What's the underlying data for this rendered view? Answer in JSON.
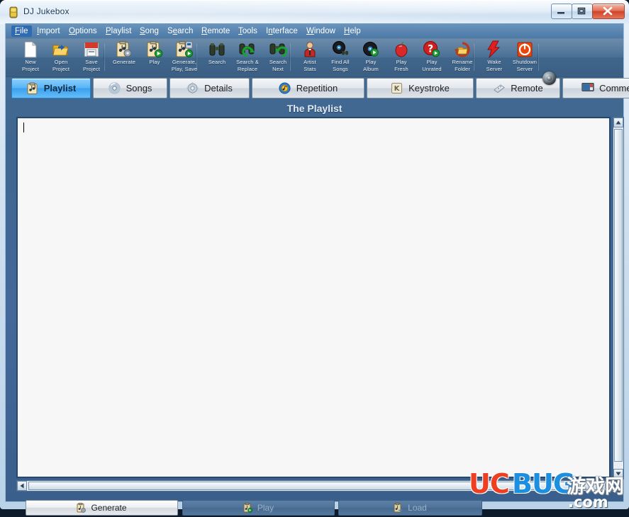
{
  "window": {
    "title": "DJ Jukebox",
    "app_icon": "jukebox-icon",
    "minimize_label": "Minimize",
    "maximize_label": "Maximize",
    "close_label": "Close"
  },
  "menubar": {
    "items": [
      {
        "label": "File",
        "mnemonic": "F",
        "active": true
      },
      {
        "label": "Import",
        "mnemonic": "I",
        "active": false
      },
      {
        "label": "Options",
        "mnemonic": "O",
        "active": false
      },
      {
        "label": "Playlist",
        "mnemonic": "P",
        "active": false
      },
      {
        "label": "Song",
        "mnemonic": "S",
        "active": false
      },
      {
        "label": "Search",
        "mnemonic": "e",
        "active": false
      },
      {
        "label": "Remote",
        "mnemonic": "R",
        "active": false
      },
      {
        "label": "Tools",
        "mnemonic": "T",
        "active": false
      },
      {
        "label": "Interface",
        "mnemonic": "n",
        "active": false
      },
      {
        "label": "Window",
        "mnemonic": "W",
        "active": false
      },
      {
        "label": "Help",
        "mnemonic": "H",
        "active": false
      }
    ]
  },
  "toolbar": {
    "buttons": [
      {
        "line1": "New",
        "line2": "Project",
        "icon": "new-document-icon"
      },
      {
        "line1": "Open",
        "line2": "Project",
        "icon": "open-folder-icon"
      },
      {
        "line1": "Save",
        "line2": "Project",
        "icon": "save-disk-icon"
      },
      {
        "line1": "Generate",
        "line2": "",
        "icon": "clipboard-gear-icon"
      },
      {
        "line1": "Play",
        "line2": "",
        "icon": "clipboard-play-icon"
      },
      {
        "line1": "Generate,",
        "line2": "Play, Save",
        "icon": "clipboard-generate-play-save-icon"
      },
      {
        "line1": "Search",
        "line2": "",
        "icon": "binoculars-icon"
      },
      {
        "line1": "Search &",
        "line2": "Replace",
        "icon": "binoculars-replace-icon"
      },
      {
        "line1": "Search",
        "line2": "Next",
        "icon": "binoculars-next-icon"
      },
      {
        "line1": "Artist",
        "line2": "Stats",
        "icon": "artist-person-icon"
      },
      {
        "line1": "Find All",
        "line2": "Songs",
        "icon": "find-all-songs-icon"
      },
      {
        "line1": "Play",
        "line2": "Album",
        "icon": "play-album-icon"
      },
      {
        "line1": "Play",
        "line2": "Fresh",
        "icon": "apple-icon"
      },
      {
        "line1": "Play",
        "line2": "Unrated",
        "icon": "question-play-icon"
      },
      {
        "line1": "Rename",
        "line2": "Folder",
        "icon": "rename-folder-icon"
      },
      {
        "line1": "Wake",
        "line2": "Server",
        "icon": "wake-server-icon"
      },
      {
        "line1": "Shutdown",
        "line2": "Server",
        "icon": "shutdown-server-icon"
      }
    ],
    "volume_label": "Volume"
  },
  "tabs": [
    {
      "label": "Playlist",
      "icon": "playlist-clipboard-icon",
      "selected": true
    },
    {
      "label": "Songs",
      "icon": "cd-disc-icon",
      "selected": false
    },
    {
      "label": "Details",
      "icon": "gear-icon",
      "selected": false
    },
    {
      "label": "Repetition",
      "icon": "repeat-circle-icon",
      "selected": false
    },
    {
      "label": "Keystroke",
      "icon": "key-k-icon",
      "selected": false
    },
    {
      "label": "Remote",
      "icon": "remote-control-icon",
      "selected": false
    },
    {
      "label": "Commercials",
      "icon": "tv-screen-icon",
      "selected": false
    }
  ],
  "page": {
    "header": "The Playlist"
  },
  "editor": {
    "value": "",
    "placeholder": ""
  },
  "bottom_buttons": [
    {
      "label": "Generate",
      "icon": "generate-icon",
      "enabled": true
    },
    {
      "label": "Play",
      "icon": "play-icon",
      "enabled": false
    },
    {
      "label": "Load",
      "icon": "load-icon",
      "enabled": false
    }
  ],
  "watermark": {
    "uc": "UC",
    "bug": "BUG",
    "cn": "游戏网",
    "com": ".com"
  },
  "colors": {
    "accent_blue": "#3aa1f0",
    "app_body": "#44689a",
    "titlebar": "#dfeaf6",
    "close_red": "#cf4427",
    "editor_bg": "#f7f7f7"
  }
}
